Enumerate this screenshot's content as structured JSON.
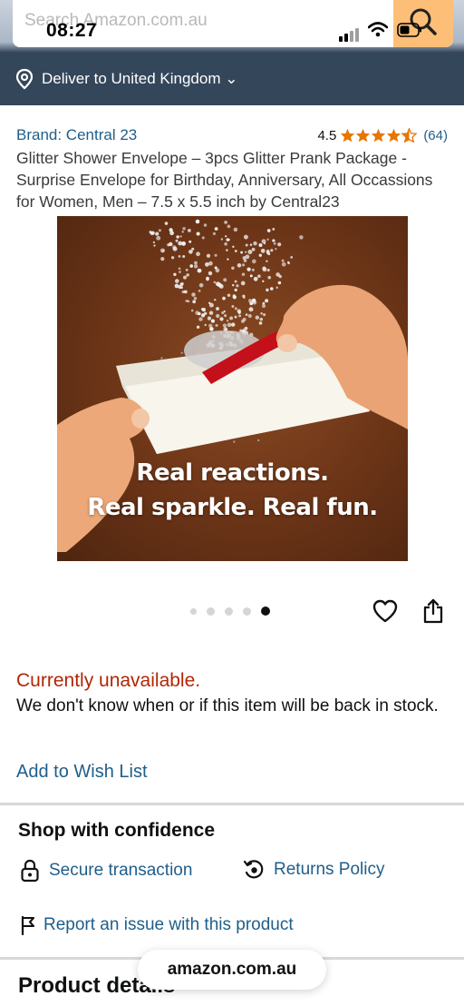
{
  "status_bar": {
    "time": "08:27"
  },
  "search": {
    "placeholder": "Search Amazon.com.au"
  },
  "deliver": {
    "label": "Deliver to United Kingdom ⌄"
  },
  "product": {
    "brand": "Brand: Central 23",
    "rating_value": "4.5",
    "rating_count": "(64)",
    "rating_stars": 4.5,
    "title": "Glitter Shower Envelope – 3pcs Glitter Prank Package - Surprise Envelope for Birthday, Anniversary, All Occassions for Women, Men – 7.5 x 5.5 inch by Central23",
    "image_caption_line1": "Real reactions.",
    "image_caption_line2": "Real sparkle. Real fun.",
    "image_count": 5,
    "active_image": 5
  },
  "availability": {
    "status": "Currently unavailable.",
    "note": "We don't know when or if this item will be back in stock."
  },
  "wishlist": {
    "label": "Add to Wish List"
  },
  "confidence": {
    "title": "Shop with confidence",
    "secure": "Secure transaction",
    "returns": "Returns Policy",
    "report": "Report an issue with this product"
  },
  "details": {
    "title": "Product details"
  },
  "browser": {
    "url": "amazon.com.au"
  },
  "colors": {
    "link": "#1f5e8a",
    "unavailable": "#b12704",
    "star": "#e77600",
    "search_button": "#fdbf78",
    "deliver_bar": "#34465a"
  }
}
